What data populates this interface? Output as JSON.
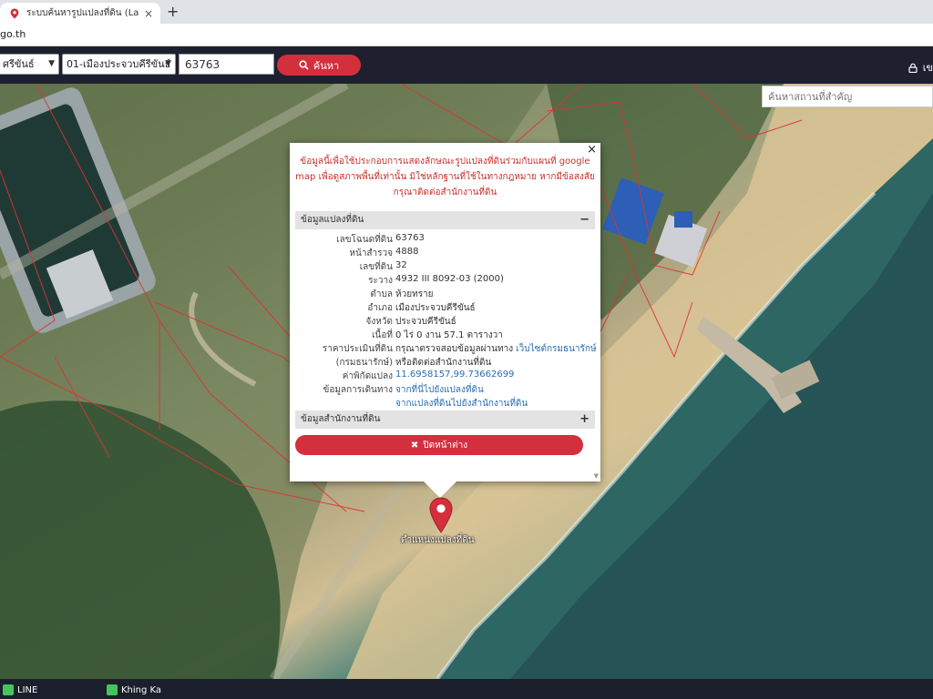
{
  "browser": {
    "tab_title": "ระบบค้นหารูปแปลงที่ดิน (LandsMaps)",
    "tab_close": "×",
    "new_tab": "+",
    "url_fragment": "go.th"
  },
  "toolbar": {
    "province_value": "ศรีขันธ์",
    "district_value": "01-เมืองประจวบคีรีขันธ์",
    "parcel_value": "63763",
    "search_label": "ค้นหา",
    "login_label": "เข"
  },
  "map": {
    "place_search_placeholder": "ค้นหาสถานที่สำคัญ",
    "marker_label": "ตำแหน่งแปลงที่ดิน"
  },
  "popup": {
    "close_symbol": "×",
    "disclaimer": "ข้อมูลนี้เพื่อใช้ประกอบการแสดงลักษณะรูปแปลงที่ดินร่วมกับแผนที่ google map เพื่อดูสภาพพื้นที่เท่านั้น มิใช่หลักฐานที่ใช้ในทางกฎหมาย หากมีข้อสงสัย กรุณาติดต่อสำนักงานที่ดิน",
    "section_parcel": "ข้อมูลแปลงที่ดิน",
    "section_parcel_toggle": "−",
    "section_office": "ข้อมูลสำนักงานที่ดิน",
    "section_office_toggle": "+",
    "rows": [
      {
        "label": "เลขโฉนดที่ดิน",
        "value": "63763"
      },
      {
        "label": "หน้าสำรวจ",
        "value": "4888"
      },
      {
        "label": "เลขที่ดิน",
        "value": "32"
      },
      {
        "label": "ระวาง",
        "value": "4932 III 8092-03 (2000)"
      },
      {
        "label": "ตำบล",
        "value": "ห้วยทราย"
      },
      {
        "label": "อำเภอ",
        "value": "เมืองประจวบคีรีขันธ์"
      },
      {
        "label": "จังหวัด",
        "value": "ประจวบคีรีขันธ์"
      },
      {
        "label": "เนื้อที่",
        "value": "0 ไร่ 0 งาน 57.1 ตารางวา"
      }
    ],
    "price_label": "ราคาประเมินที่ดิน",
    "price_label2": "(กรมธนารักษ์)",
    "price_value": "กรุณาตรวจสอบข้อมูลผ่านทาง",
    "price_link": "เว็บไซต์กรมธนารักษ์",
    "price_value2": "หรือติดต่อสำนักงานที่ดิน",
    "coord_label": "ค่าพิกัดแปลง",
    "coord_value": "11.6958157,99.73662699",
    "route_label": "ข้อมูลการเดินทาง",
    "route_link1": "จากที่นี่ไปยังแปลงที่ดิน",
    "route_link2": "จากแปลงที่ดินไปยังสำนักงานที่ดิน",
    "close_window_label": "ปิดหน้าต่าง",
    "close_window_icon": "✖"
  },
  "taskbar": {
    "item1": "LINE",
    "item2": "Khing Ka"
  },
  "colors": {
    "brand_red": "#d42f3c",
    "toolbar_bg": "#1e2030",
    "link_blue": "#2a6db0"
  }
}
